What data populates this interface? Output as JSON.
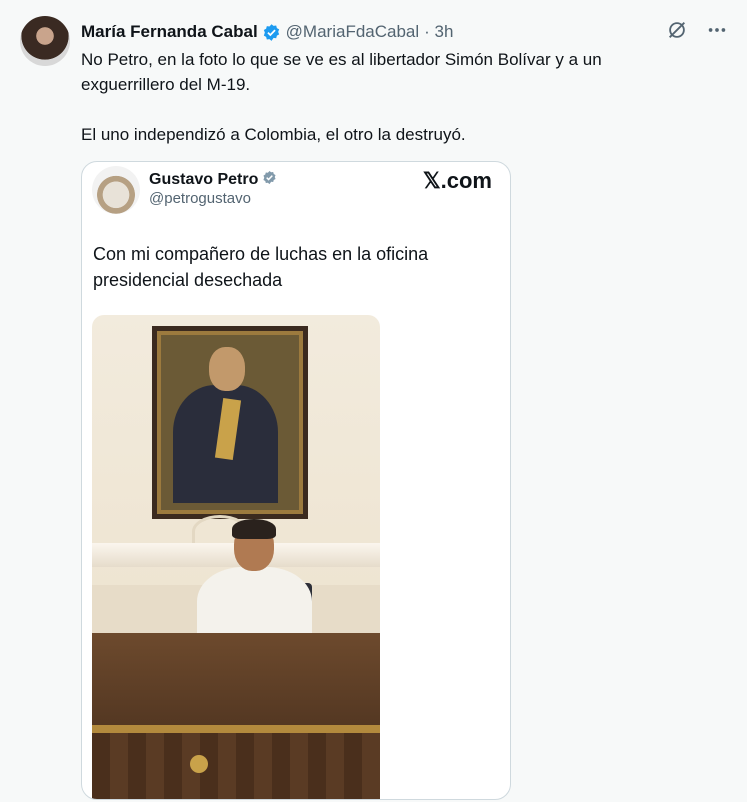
{
  "author": {
    "name": "María Fernanda Cabal",
    "handle": "@MariaFdaCabal",
    "time": "· 3h"
  },
  "tweet_text": {
    "line1": "No Petro, en la foto lo que se ve es al libertador Simón Bolívar y a un",
    "line2": "exguerrillero del M-19.",
    "line3": "El uno independizó a Colombia, el otro la destruyó."
  },
  "icons": {
    "verified": "verified-badge-icon",
    "grok": "grok-icon",
    "more": "more-options-icon"
  },
  "quoted": {
    "name": "Gustavo Petro",
    "handle": "@petrogustavo",
    "brand": "𝕏.com",
    "text_line1": "Con mi compañero de luchas en la oficina",
    "text_line2": "presidencial  desechada"
  },
  "colors": {
    "verified_blue": "#1d9bf0",
    "verified_gray": "#829aab",
    "text_primary": "#0f1419",
    "text_secondary": "#536471"
  }
}
